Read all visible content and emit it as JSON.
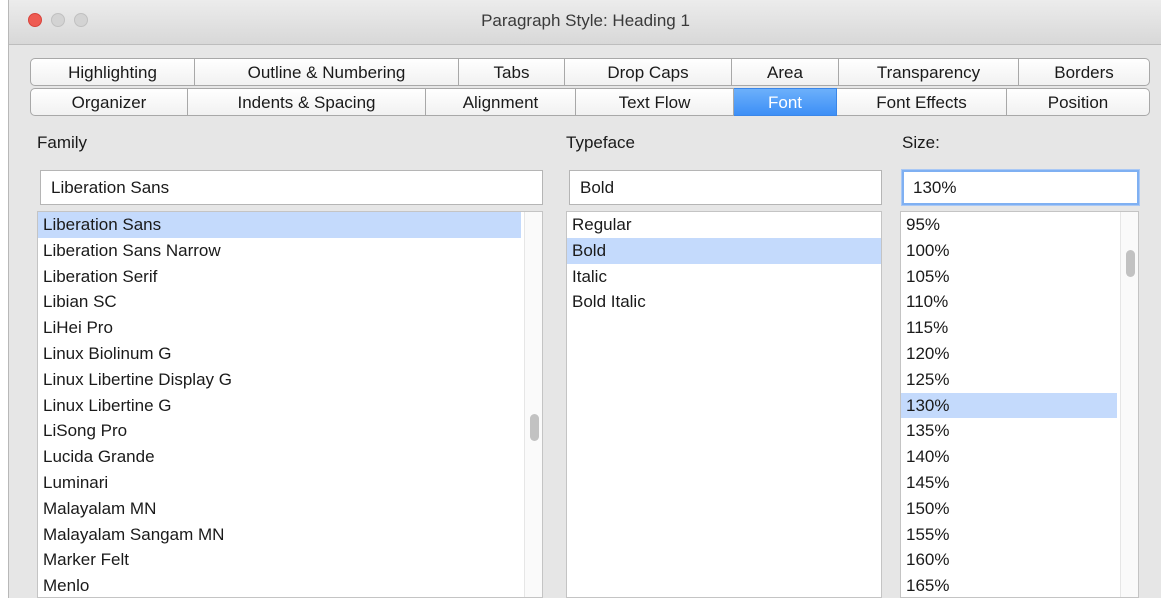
{
  "window": {
    "title": "Paragraph Style: Heading 1"
  },
  "tabs": {
    "row1": [
      "Highlighting",
      "Outline & Numbering",
      "Tabs",
      "Drop Caps",
      "Area",
      "Transparency",
      "Borders"
    ],
    "row2": [
      "Organizer",
      "Indents & Spacing",
      "Alignment",
      "Text Flow",
      "Font",
      "Font Effects",
      "Position"
    ],
    "active": "Font"
  },
  "family": {
    "label": "Family",
    "value": "Liberation Sans",
    "items": [
      "Liberation Sans",
      "Liberation Sans Narrow",
      "Liberation Serif",
      "Libian SC",
      "LiHei Pro",
      "Linux Biolinum G",
      "Linux Libertine Display G",
      "Linux Libertine G",
      "LiSong Pro",
      "Lucida Grande",
      "Luminari",
      "Malayalam MN",
      "Malayalam Sangam MN",
      "Marker Felt",
      "Menlo"
    ],
    "selected": "Liberation Sans"
  },
  "typeface": {
    "label": "Typeface",
    "value": "Bold",
    "items": [
      "Regular",
      "Bold",
      "Italic",
      "Bold Italic"
    ],
    "selected": "Bold"
  },
  "size": {
    "label": "Size:",
    "value": "130%",
    "items": [
      "95%",
      "100%",
      "105%",
      "110%",
      "115%",
      "120%",
      "125%",
      "130%",
      "135%",
      "140%",
      "145%",
      "150%",
      "155%",
      "160%",
      "165%"
    ],
    "selected": "130%"
  },
  "colors": {
    "active_tab": "#4a97f8",
    "selection": "#c4dafc",
    "focus_ring": "#7fb0f2"
  }
}
